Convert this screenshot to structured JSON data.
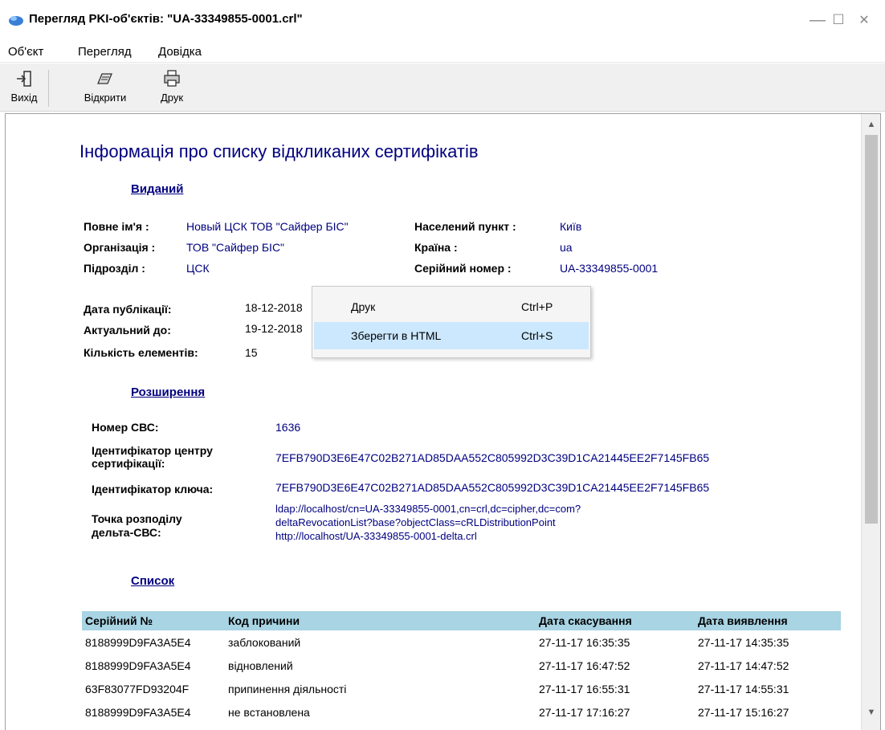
{
  "window": {
    "title": "Перегляд PKI-об'єктів: \"UA-33349855-0001.crl\"",
    "minimize": "—",
    "maximize": "☐",
    "close": "✕"
  },
  "menu": [
    "Об'єкт",
    "Перегляд",
    "Довідка"
  ],
  "toolbar": [
    {
      "label": "Вихід",
      "icon": "exit-icon"
    },
    {
      "label": "Відкрити",
      "icon": "open-icon"
    },
    {
      "label": "Друк",
      "icon": "print-icon"
    }
  ],
  "doc": {
    "heading": "Інформація про списку відкликаних сертифікатів",
    "issuer": {
      "section": "Виданий",
      "full_name_label": "Повне ім'я :",
      "full_name": "Новый ЦСК ТОВ \"Сайфер БІС\"",
      "org_label": "Організація :",
      "org": "ТОВ \"Сайфер БІС\"",
      "unit_label": "Підрозділ :",
      "unit": "ЦСК",
      "locality_label": "Населений пункт :",
      "locality": "Київ",
      "country_label": "Країна :",
      "country": "ua",
      "serial_label": "Серійний номер :",
      "serial": "UA-33349855-0001"
    },
    "dates": {
      "published_label": "Дата публікації:",
      "published": "18-12-2018",
      "valid_label": "Актуальний до:",
      "valid": "19-12-2018",
      "count_label": "Кількість елементів:",
      "count": "15"
    },
    "ext": {
      "section": "Розширення",
      "crl_num_label": "Номер СВС:",
      "crl_num": "1636",
      "ca_id_label_1": "Ідентифікатор центру",
      "ca_id_label_2": "сертифікації:",
      "ca_id": "7EFB790D3E6E47C02B271AD85DAA552C805992D3C39D1CA21445EE2F7145FB65",
      "key_id_label": "Ідентифікатор ключа:",
      "key_id": "7EFB790D3E6E47C02B271AD85DAA552C805992D3C39D1CA21445EE2F7145FB65",
      "delta_label_1": "Точка розподілу",
      "delta_label_2": "дельта-СВС:",
      "delta_1": "ldap://localhost/cn=UA-33349855-0001,cn=crl,dc=cipher,dc=com?",
      "delta_2": "deltaRevocationList?base?objectClass=cRLDistributionPoint",
      "delta_3": "http://localhost/UA-33349855-0001-delta.crl"
    },
    "list": {
      "section": "Список",
      "headers": [
        "Серійний №",
        "Код причини",
        "Дата скасування",
        "Дата виявлення"
      ],
      "rows": [
        [
          "8188999D9FA3A5E4",
          "заблокований",
          "27-11-17 16:35:35",
          "27-11-17 14:35:35"
        ],
        [
          "8188999D9FA3A5E4",
          "відновлений",
          "27-11-17 16:47:52",
          "27-11-17 14:47:52"
        ],
        [
          "63F83077FD93204F",
          "припинення діяльності",
          "27-11-17 16:55:31",
          "27-11-17 14:55:31"
        ],
        [
          "8188999D9FA3A5E4",
          "не встановлена",
          "27-11-17 17:16:27",
          "27-11-17 15:16:27"
        ]
      ]
    }
  },
  "context_menu": [
    {
      "label": "Друк",
      "shortcut": "Ctrl+P"
    },
    {
      "label": "Зберегти в HTML",
      "shortcut": "Ctrl+S"
    }
  ],
  "colors": {
    "link": "#000080",
    "table_header": "#a8d4e4",
    "menu_hover": "#cce8ff"
  }
}
